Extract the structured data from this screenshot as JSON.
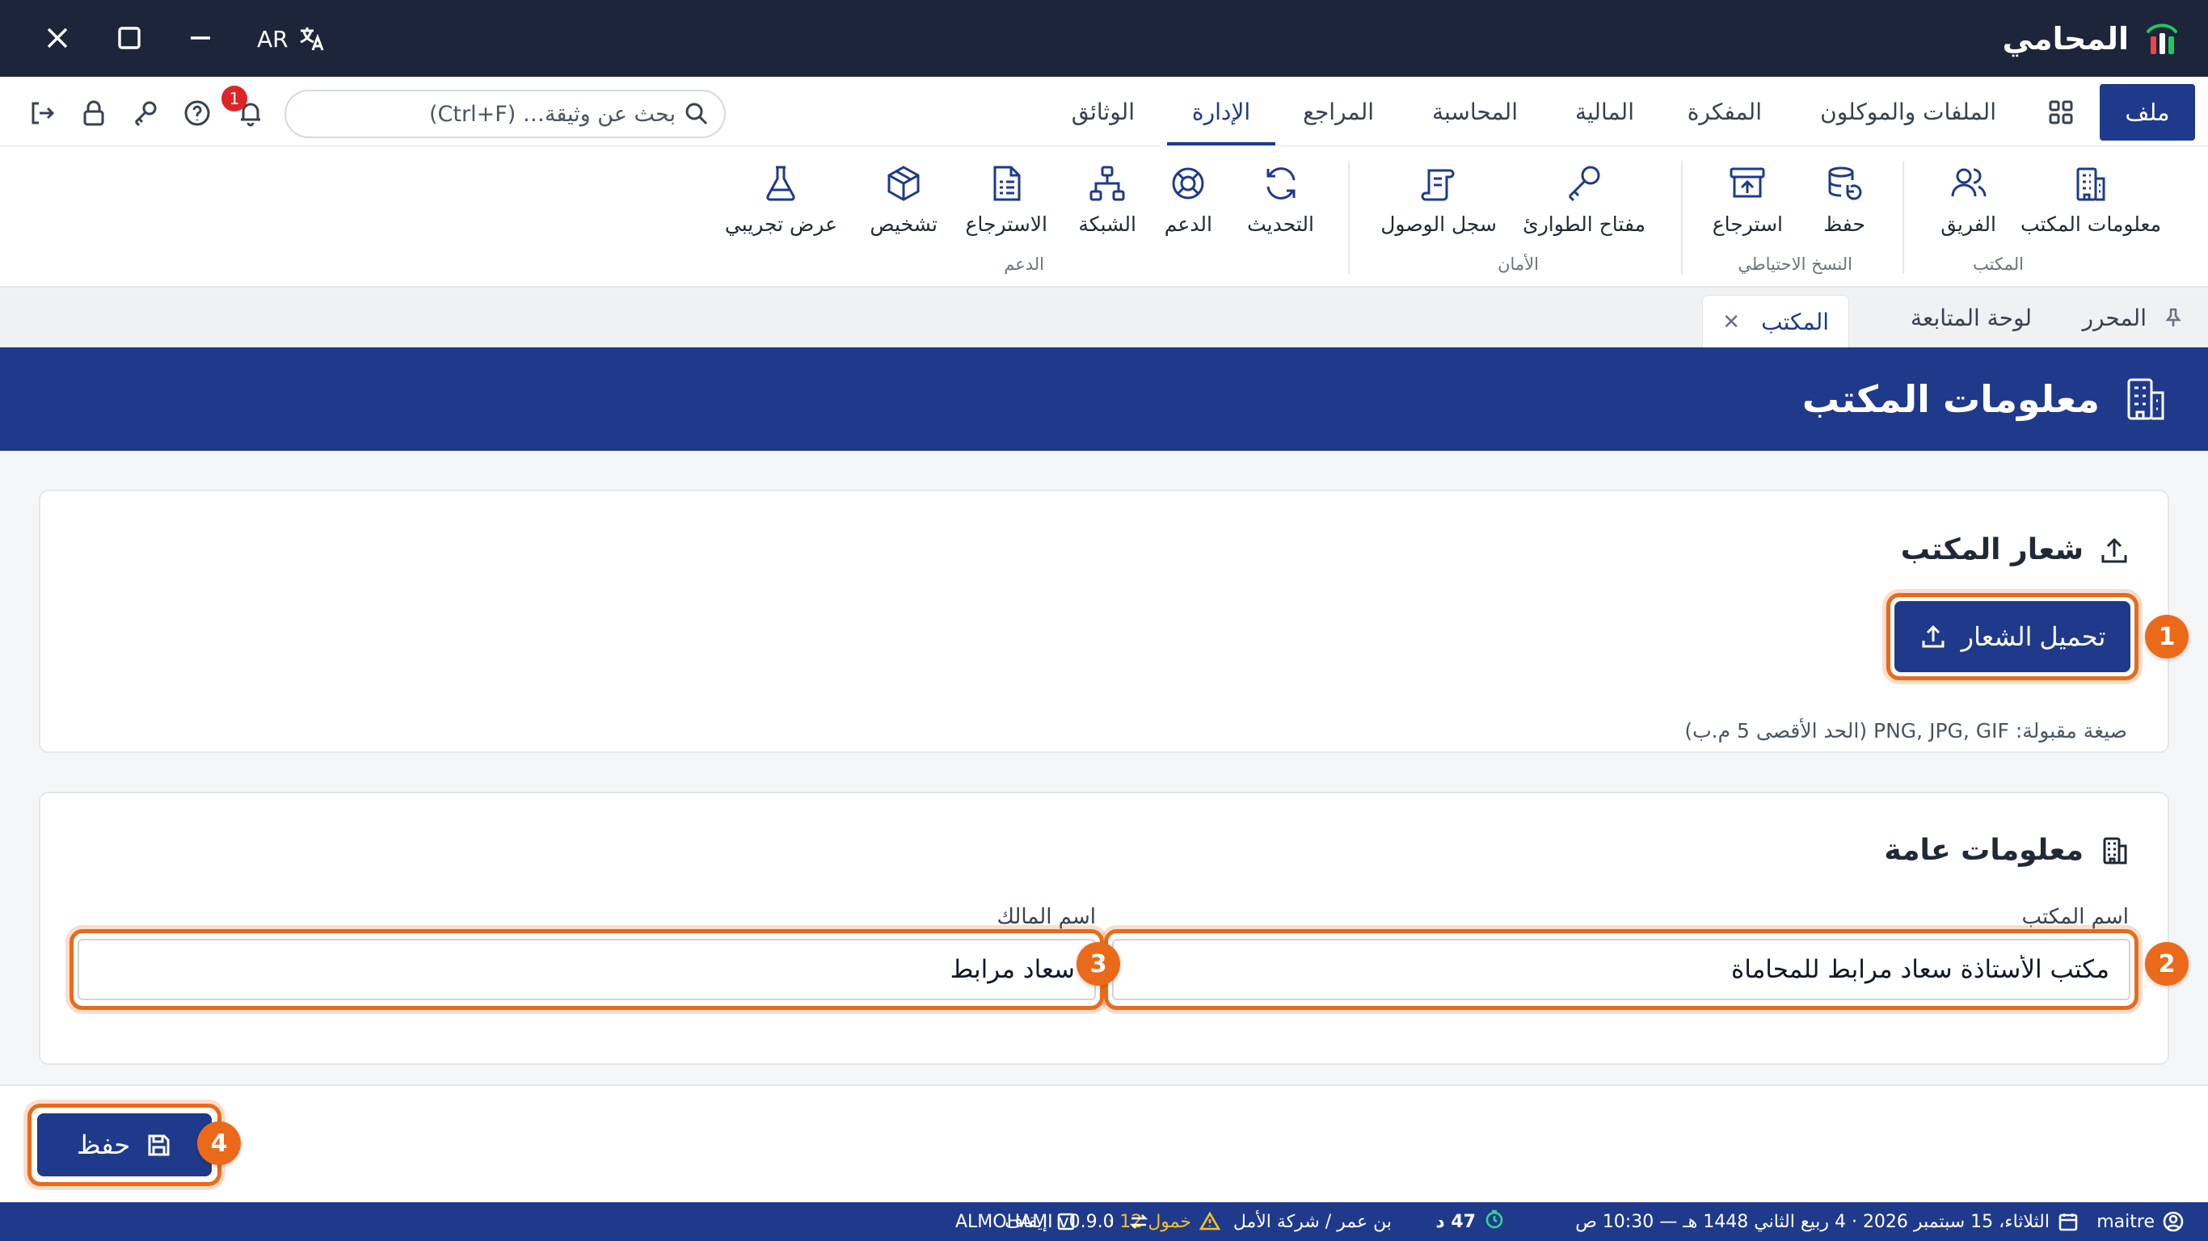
{
  "app": {
    "brand_name": "المحامي",
    "language": "AR"
  },
  "menubar": {
    "file_label": "ملف",
    "tabs": [
      {
        "label": "الملفات والموكلون"
      },
      {
        "label": "المفكرة"
      },
      {
        "label": "المالية"
      },
      {
        "label": "المحاسبة"
      },
      {
        "label": "المراجع"
      },
      {
        "label": "الإدارة"
      },
      {
        "label": "الوثائق"
      }
    ],
    "active_tab": "الإدارة",
    "search_placeholder": "بحث عن وثيقة… (Ctrl+F)",
    "notification_count": "1"
  },
  "ribbon": {
    "groups": [
      {
        "name": "المكتب",
        "items": [
          "معلومات المكتب",
          "الفريق"
        ]
      },
      {
        "name": "النسخ الاحتياطي",
        "items": [
          "حفظ",
          "استرجاع"
        ]
      },
      {
        "name": "الأمان",
        "items": [
          "مفتاح الطوارئ",
          "سجل الوصول"
        ]
      },
      {
        "name": "الدعم",
        "items": [
          "التحديث",
          "الدعم",
          "الشبكة",
          "الاسترجاع",
          "تشخيص",
          "عرض تجريبي"
        ]
      }
    ]
  },
  "doctabs": {
    "items": [
      {
        "label": "المحرر"
      },
      {
        "label": "لوحة المتابعة"
      },
      {
        "label": "المكتب",
        "closable": true
      }
    ],
    "active": "المكتب"
  },
  "page": {
    "title": "معلومات المكتب"
  },
  "logo_section": {
    "title": "شعار المكتب",
    "upload_button": "تحميل الشعار",
    "hint": "صيغة مقبولة: PNG, JPG, GIF (الحد الأقصى 5 م.ب)"
  },
  "general_section": {
    "title": "معلومات عامة",
    "office_name_label": "اسم المكتب",
    "office_name_value": "مكتب الأستاذة سعاد مرابط للمحاماة",
    "owner_name_label": "اسم المالك",
    "owner_name_value": "سعاد مرابط"
  },
  "footer": {
    "save_button": "حفظ"
  },
  "steps": [
    "1",
    "2",
    "3",
    "4"
  ],
  "statusbar": {
    "user": "maitre",
    "date": "الثلاثاء، 15 سبتمبر 2026 · 4 ربيع الثاني 1448 هـ — 10:30 ص",
    "timer": "47 د",
    "client": "بن عمر / شركة الأمل",
    "idle_warning": "خمول 12 د",
    "stop_label": "إيقاف",
    "version": "ALMOHAMI v0.9.0"
  },
  "colors": {
    "titlebar": "#1c2539",
    "primary": "#1f3a8a",
    "highlight": "#ea6a1a",
    "warning": "#fbbf24",
    "badge": "#dc2626"
  },
  "icons": {
    "window": [
      "close-icon",
      "maximize-icon",
      "minimize-icon",
      "translate-icon"
    ],
    "toolbar": [
      "logout-icon",
      "lock-icon",
      "key-icon",
      "help-icon",
      "bell-icon",
      "search-icon",
      "grid-icon"
    ]
  }
}
